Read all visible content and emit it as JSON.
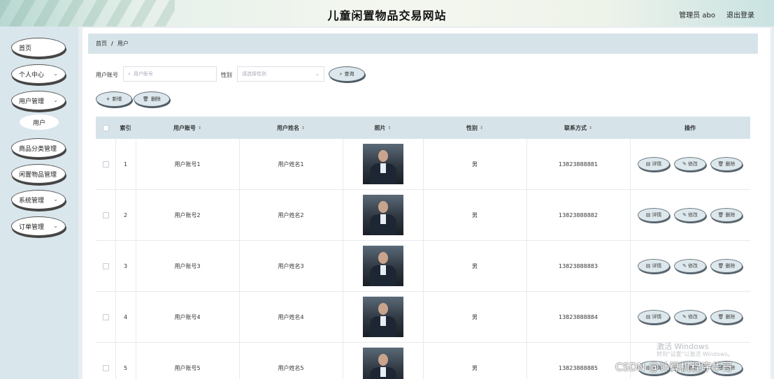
{
  "header": {
    "site_title": "儿童闲置物品交易网站",
    "admin_label": "管理员 abo",
    "logout_label": "退出登录"
  },
  "sidebar": {
    "items": [
      {
        "label": "首页",
        "has_chevron": false
      },
      {
        "label": "个人中心",
        "has_chevron": true
      },
      {
        "label": "用户管理",
        "has_chevron": true
      },
      {
        "label": "商品分类管理",
        "has_chevron": true
      },
      {
        "label": "闲置物品管理",
        "has_chevron": true
      },
      {
        "label": "系统管理",
        "has_chevron": true
      },
      {
        "label": "订单管理",
        "has_chevron": true
      }
    ],
    "submenu": {
      "label": "用户"
    }
  },
  "breadcrumb": {
    "home": "首页",
    "sep": "/",
    "current": "用户"
  },
  "search": {
    "account_label": "用户账号",
    "account_placeholder": "用户账号",
    "gender_label": "性别",
    "gender_placeholder": "请选择性别",
    "query_button": "查询"
  },
  "toolbar": {
    "add_button": "新增",
    "delete_button": "删除"
  },
  "table": {
    "headers": {
      "index": "索引",
      "account": "用户账号",
      "name": "用户姓名",
      "photo": "照片",
      "gender": "性别",
      "phone": "联系方式",
      "actions": "操作"
    },
    "rows": [
      {
        "index": "1",
        "account": "用户账号1",
        "name": "用户姓名1",
        "gender": "男",
        "phone": "13823888881"
      },
      {
        "index": "2",
        "account": "用户账号2",
        "name": "用户姓名2",
        "gender": "男",
        "phone": "13823888882"
      },
      {
        "index": "3",
        "account": "用户账号3",
        "name": "用户姓名3",
        "gender": "男",
        "phone": "13823888883"
      },
      {
        "index": "4",
        "account": "用户账号4",
        "name": "用户姓名4",
        "gender": "男",
        "phone": "13823888884"
      },
      {
        "index": "5",
        "account": "用户账号5",
        "name": "用户姓名5",
        "gender": "男",
        "phone": "13823888885"
      }
    ],
    "row_actions": {
      "detail": "详情",
      "edit": "修改",
      "delete": "删除"
    }
  },
  "overlay": {
    "windows_activate": "激活 Windows",
    "windows_activate_sub": "转到\"设置\"以激活 Windows。",
    "csdn_watermark": "CSDN @计算机程序华哥"
  }
}
